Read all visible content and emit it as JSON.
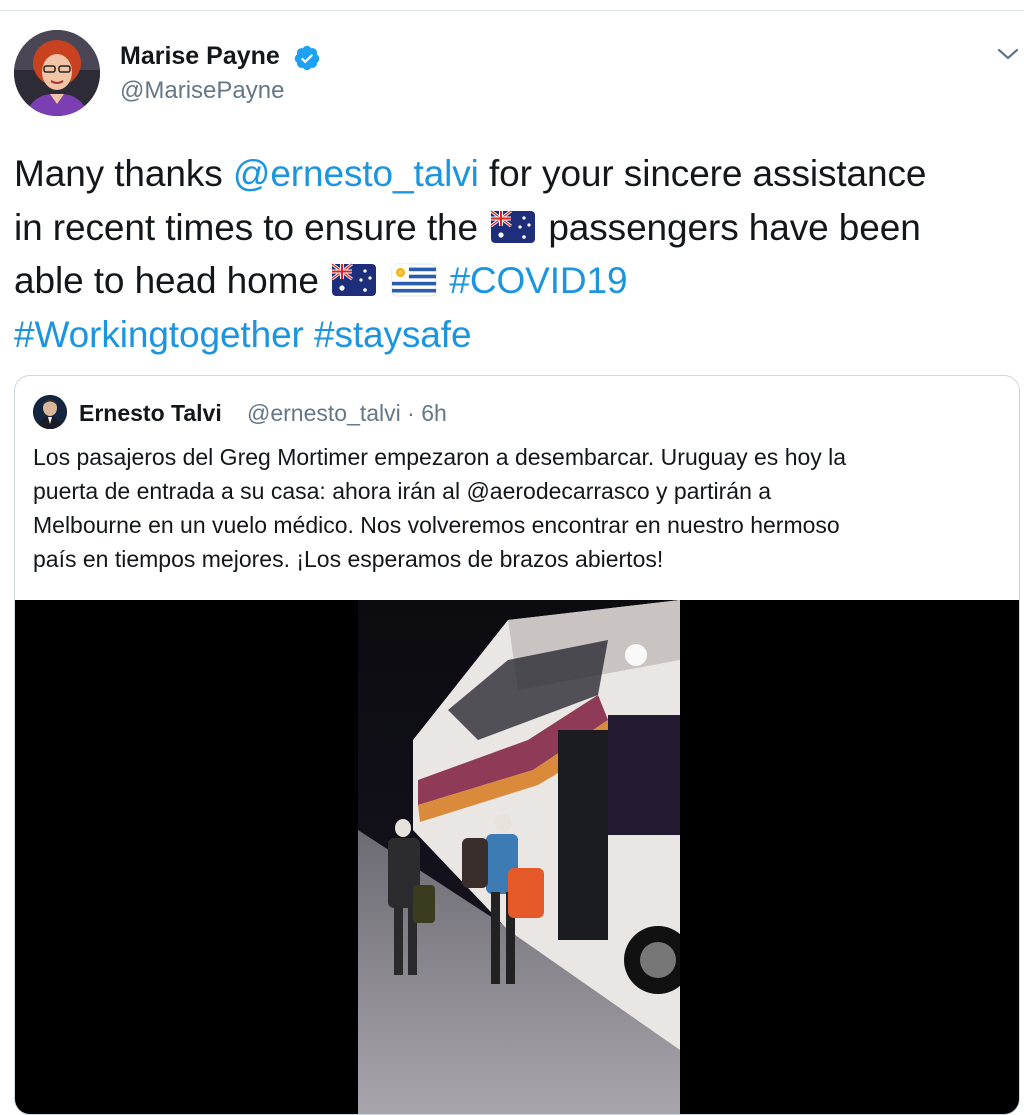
{
  "author": {
    "name": "Marise Payne",
    "handle": "@MarisePayne",
    "verified": true
  },
  "tweet": {
    "lines": [
      [
        {
          "t": "Many thanks ",
          "kind": "text"
        },
        {
          "t": "@ernesto_talvi",
          "kind": "mention"
        },
        {
          "t": " for your sincere assistance",
          "kind": "text"
        }
      ],
      [
        {
          "t": "in recent times to ensure the ",
          "kind": "text"
        },
        {
          "t": "",
          "kind": "flag-au"
        },
        {
          "t": " passengers have been",
          "kind": "text"
        }
      ],
      [
        {
          "t": "able to head home ",
          "kind": "text"
        },
        {
          "t": "",
          "kind": "flag-au"
        },
        {
          "t": " ",
          "kind": "text"
        },
        {
          "t": "",
          "kind": "flag-uy"
        },
        {
          "t": " ",
          "kind": "text"
        },
        {
          "t": "#COVID19",
          "kind": "hashtag"
        }
      ],
      [
        {
          "t": "#Workingtogether",
          "kind": "hashtag"
        },
        {
          "t": " ",
          "kind": "text"
        },
        {
          "t": "#staysafe",
          "kind": "hashtag"
        }
      ]
    ]
  },
  "quoted": {
    "name": "Ernesto Talvi",
    "handle_time": "@ernesto_talvi · 6h",
    "lines": [
      "Los pasajeros del Greg Mortimer empezaron a desembarcar. Uruguay es hoy la",
      "puerta de entrada a su casa: ahora irán al @aerodecarrasco y partirán a",
      "Melbourne en un vuelo médico. Nos volveremos encontrar en nuestro hermoso",
      "país en tiempos mejores. ¡Los esperamos de brazos abiertos!"
    ]
  },
  "colors": {
    "link": "#1b95e0",
    "text": "#14171a",
    "muted": "#657786",
    "border": "#ccd6dd"
  },
  "icons": {
    "verified": "verified-badge-icon",
    "caret": "chevron-down-icon"
  }
}
